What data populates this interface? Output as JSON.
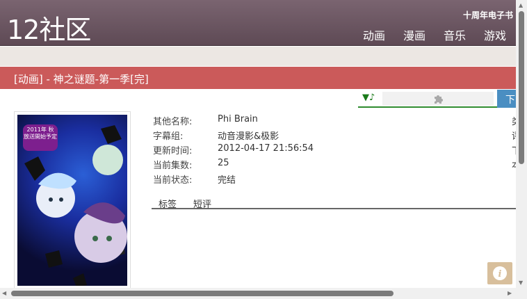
{
  "header": {
    "logo": "12社区",
    "anniversary": "十周年电子书",
    "nav": [
      "动画",
      "漫画",
      "音乐",
      "游戏"
    ]
  },
  "title": "[动画] - 神之谜题-第一季[完]",
  "download_label": "下载",
  "poster": {
    "badge_line1": "2011年 秋",
    "badge_line2": "放送開始予定"
  },
  "info": [
    {
      "label": "其他名称:",
      "value": "Phi Brain"
    },
    {
      "label": "字幕组:",
      "value": "动音漫影&极影"
    },
    {
      "label": "更新时间:",
      "value": "2012-04-17 21:56:54"
    },
    {
      "label": "当前集数:",
      "value": "25"
    },
    {
      "label": "当前状态:",
      "value": "完结"
    }
  ],
  "side_chars": [
    "类",
    "评",
    "下",
    "本"
  ],
  "tabs": [
    "标签",
    "短评"
  ],
  "colors": {
    "header": "#6b5560",
    "title_bar": "#cb5a5a",
    "accent_green": "#2e8b2e",
    "download": "#4a8ec2"
  }
}
